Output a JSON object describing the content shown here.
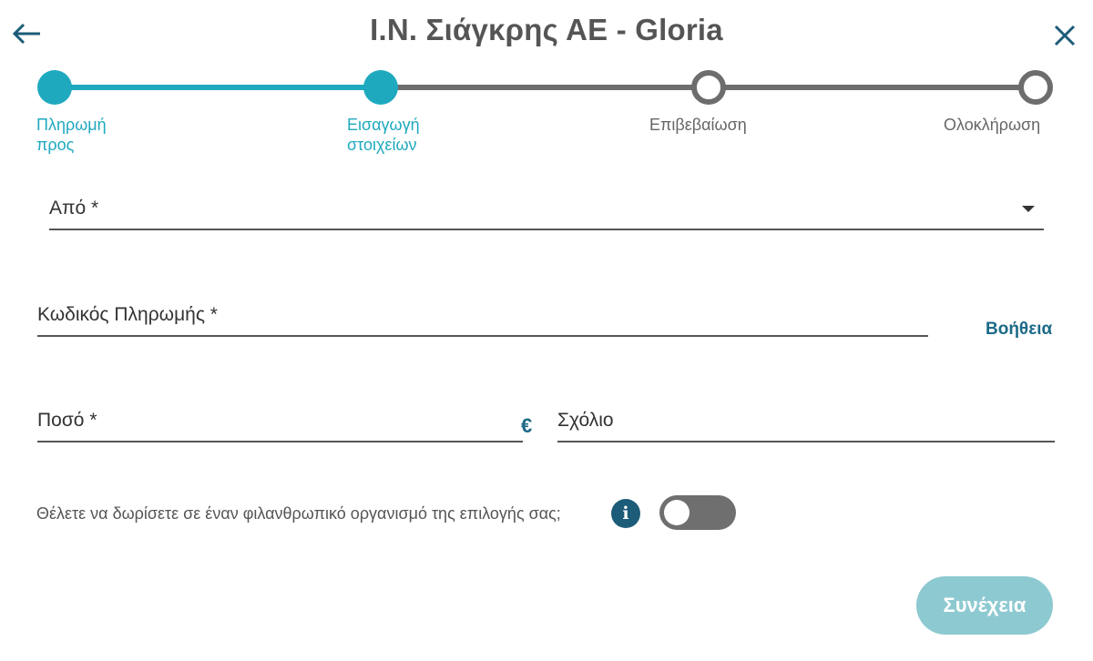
{
  "header": {
    "title": "Ι.Ν. Σιάγκρης ΑΕ - Gloria",
    "back_icon": "arrow-left-icon",
    "close_icon": "close-icon"
  },
  "stepper": {
    "steps": [
      {
        "line1": "Πληρωμή",
        "line2": "προς",
        "state": "done"
      },
      {
        "line1": "Εισαγωγή",
        "line2": "στοιχείων",
        "state": "done"
      },
      {
        "line1": "Επιβεβαίωση",
        "line2": "",
        "state": "todo"
      },
      {
        "line1": "Ολοκλήρωση",
        "line2": "",
        "state": "todo"
      }
    ]
  },
  "form": {
    "from_label": "Από *",
    "payment_code_label": "Κωδικός Πληρωμής *",
    "help_link": "Βοήθεια",
    "amount_label": "Ποσό *",
    "currency_symbol": "€",
    "comment_label": "Σχόλιο",
    "donate_question": "Θέλετε να δωρίσετε σε έναν φιλανθρωπικό οργανισμό της επιλογής σας;",
    "info_icon_glyph": "i",
    "donate_toggle_on": false
  },
  "actions": {
    "continue_label": "Συνέχεια"
  },
  "colors": {
    "accent": "#1fa9bf",
    "dark_accent": "#1c6a87",
    "inactive": "#6d6d6d",
    "button_disabled": "#8dc9d0"
  }
}
